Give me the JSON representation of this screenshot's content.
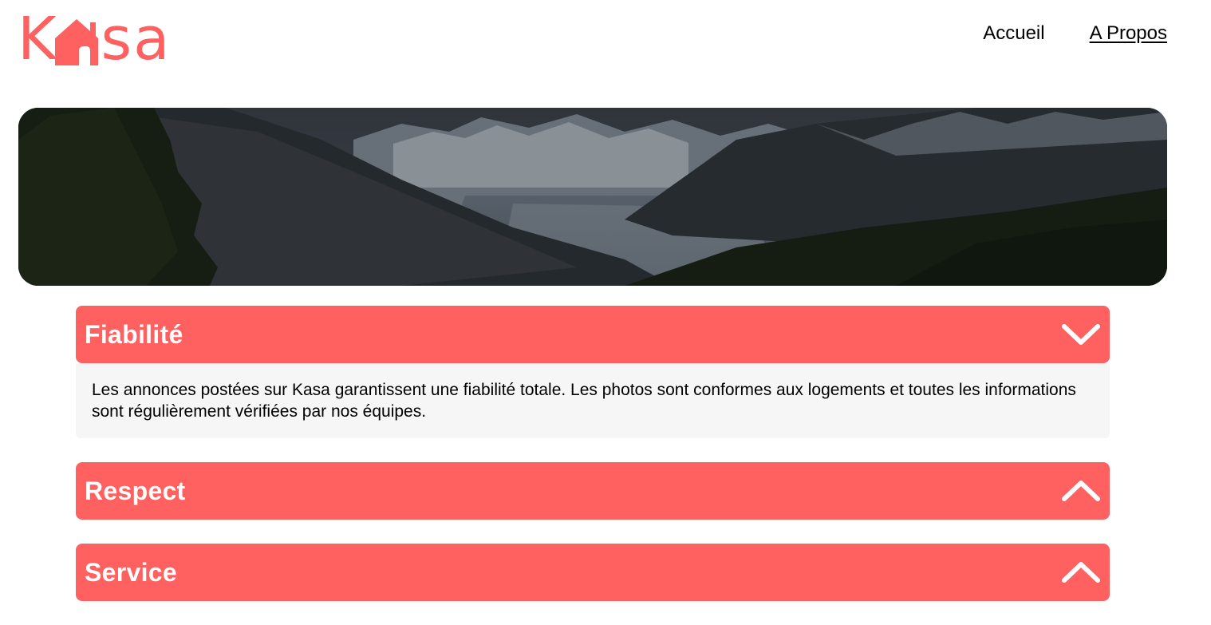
{
  "brand": {
    "logo_letters": [
      "K",
      "s",
      "a"
    ],
    "accent_color": "#FF6060",
    "logo_icon": "house-icon"
  },
  "nav": {
    "items": [
      {
        "label": "Accueil",
        "active": false
      },
      {
        "label": "A Propos",
        "active": true
      }
    ]
  },
  "banner": {
    "image": "mountain-landscape"
  },
  "collapses": [
    {
      "title": "Fiabilité",
      "open": true,
      "icon": "chevron-down-icon",
      "text": "Les annonces postées sur Kasa garantissent une fiabilité totale. Les photos sont conformes aux logements et toutes les informations sont régulièrement vérifiées par nos équipes."
    },
    {
      "title": "Respect",
      "open": false,
      "icon": "chevron-up-icon"
    },
    {
      "title": "Service",
      "open": false,
      "icon": "chevron-up-icon"
    }
  ]
}
